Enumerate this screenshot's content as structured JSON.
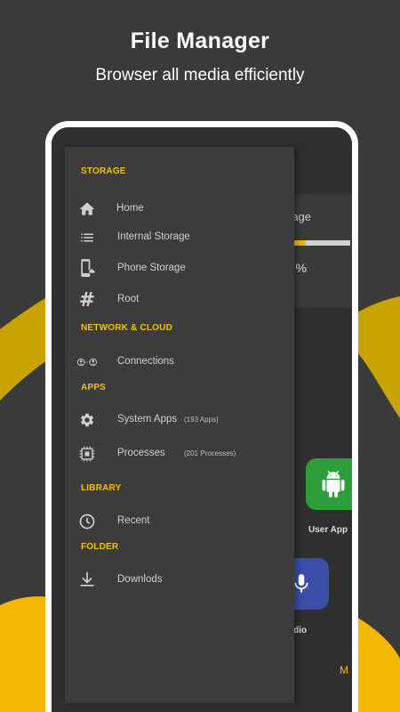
{
  "promo": {
    "title": "File Manager",
    "subtitle": "Browser all media efficiently"
  },
  "colors": {
    "accent": "#f5c000",
    "background": "#3a3a3a",
    "drawer": "#3c3c3c",
    "text_muted": "#d0d0d0"
  },
  "background_screen": {
    "storage_card": {
      "title_fragment": "rage",
      "percent_fragment": "- %",
      "usage_fraction": 0.28
    },
    "apps": {
      "user_apps_label": "User App",
      "audio_label": "udio",
      "more_fragment": "M"
    }
  },
  "drawer": {
    "sections": {
      "storage": "STORAGE",
      "network": "NETWORK & CLOUD",
      "apps": "APPS",
      "library": "LIBRARY",
      "folder": "FOLDER"
    },
    "items": [
      {
        "label": "Home",
        "icon": "home-icon"
      },
      {
        "label": "Internal Storage",
        "icon": "list-icon"
      },
      {
        "label": "Phone Storage",
        "icon": "phone-cloud-icon"
      },
      {
        "label": "Root",
        "icon": "hash-icon"
      },
      {
        "label": "Connections",
        "icon": "connections-icon"
      },
      {
        "label": "System Apps",
        "icon": "gear-icon",
        "count": "(193 Apps)"
      },
      {
        "label": "Processes",
        "icon": "chip-icon",
        "count": "(201 Processes)"
      },
      {
        "label": "Recent",
        "icon": "clock-icon"
      },
      {
        "label": "Downlods",
        "icon": "download-icon"
      }
    ]
  }
}
